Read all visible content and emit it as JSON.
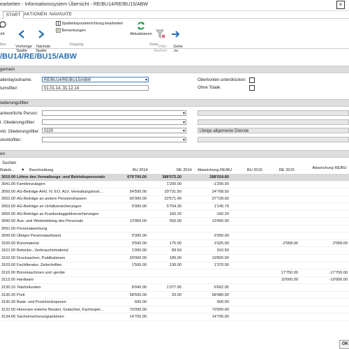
{
  "window": {
    "title": "earbeiten - Informationssystem Übersicht - RE/BU14/RE/BU15/ABW",
    "close": "×"
  },
  "tabs": [
    {
      "label": "START"
    },
    {
      "label": "AKTIONEN"
    },
    {
      "label": "NAVIGATE"
    }
  ],
  "ribbon": {
    "buttons": [
      {
        "label": "cht",
        "icon": "search-icon"
      },
      {
        "label": "Vorherige\nSpalte",
        "icon": "arrow-left-icon"
      },
      {
        "label": "Nächste\nSpalte",
        "icon": "arrow-right-icon"
      },
      {
        "label": "Spaltenlayouteinrichtung bearbeiten",
        "icon": "layout-icon"
      },
      {
        "label": "Bemerkungen",
        "icon": "note-icon"
      },
      {
        "label": "Aktualisieren",
        "icon": "refresh-icon"
      },
      {
        "label": "Filter\nlöschen",
        "icon": "clear-filter-icon"
      },
      {
        "label": "Gehe\nzu",
        "icon": "goto-icon"
      }
    ],
    "groups": {
      "g1": "lten",
      "g2": "Vorgang",
      "g3": "Seite"
    }
  },
  "page_title": "/BU14/RE/BU15/ABW",
  "allgemein": {
    "header": "gemein",
    "layout_label": "altenlayoutname:",
    "layout_value": "RE/BU14/RE/BU15/ABW",
    "date_label": "tumsfilter:",
    "date_value": "01.01.14..31.12.14",
    "suppress_label": "Oberkonten unterdrücken:",
    "totals_label": "Ohne Totale:"
  },
  "gliederung": {
    "header": "iederungsfilter",
    "person_label": "antwortliche Person:",
    "filter1_label": "t. Gliederungsfilter:",
    "filter2_label": "nkt. Gliederungsfilter:",
    "filter2_value": "0220",
    "filter2_desc": "Übrige allgemeine Dienste",
    "konto_label": "ukontofilter:"
  },
  "lines": {
    "header": "en",
    "search": "Suchen",
    "columns": [
      "Rubrik...",
      "Beschreibung",
      "BU 2014",
      "RE 2014",
      "Abweichung RE/BU",
      "BU 2015",
      "RE 2015",
      "Abweichung RE/BU"
    ],
    "rows": [
      [
        "3010.00",
        "Löhne des Verwaltungs- und Betriebspersonals",
        "679'700.00",
        "388'675.20",
        "288'024.80",
        "",
        "",
        ""
      ],
      [
        "3041.00",
        "Familienzulagen",
        "",
        "1'200.00",
        "-1'200.00",
        "",
        "",
        ""
      ],
      [
        "3050.00",
        "AG-Beiträge AHV, IV, EO, ALV, Verwaltungskost...",
        "54'500.00",
        "29'731.50",
        "24'768.50",
        "",
        "",
        ""
      ],
      [
        "3052.00",
        "AG-Beiträge an andere Pensionskassen",
        "60'300.00",
        "22'571.40",
        "37'728.60",
        "",
        "",
        ""
      ],
      [
        "3053.00",
        "AG-Beiträge an Unfallversicherungen",
        "6'900.00",
        "5'754.30",
        "1'145.70",
        "",
        "",
        ""
      ],
      [
        "3055.00",
        "AG-Beiträge an Krankentaggeldversicherungen",
        "",
        "160.20",
        "-160.20",
        "",
        "",
        ""
      ],
      [
        "3090.00",
        "Aus- und Weiterbildung des Personals",
        "13'950.00",
        "550.00",
        "13'400.00",
        "",
        "",
        ""
      ],
      [
        "3091.00",
        "Personalwerbung",
        "",
        "",
        "",
        "",
        "",
        ""
      ],
      [
        "3099.00",
        "Übriger Personalaufwand",
        "9'300.00",
        "",
        "9'300.00",
        "",
        "",
        ""
      ],
      [
        "3100.00",
        "Büromaterial",
        "3'500.00",
        "175.00",
        "3'325.00",
        "",
        "-2'058.00",
        "2'058.00"
      ],
      [
        "3101.00",
        "Betriebs-, Verbrauchsmaterial",
        "1'000.00",
        "89.50",
        "910.50",
        "",
        "",
        ""
      ],
      [
        "3102.00",
        "Drucksachen, Publikationen",
        "20'000.00",
        "180.00",
        "19'820.00",
        "",
        "",
        ""
      ],
      [
        "3103.00",
        "Fachliteratur, Zeitschriften",
        "1'500.00",
        "130.00",
        "1'370.00",
        "",
        "",
        ""
      ],
      [
        "3110.00",
        "Büromaschinen und -geräte",
        "",
        "",
        "",
        "",
        "17'750.00",
        "-17'750.00"
      ],
      [
        "3113.00",
        "Hardware",
        "",
        "",
        "",
        "",
        "10'000.00",
        "-10'000.00"
      ],
      [
        "3130.10",
        "Telefonkosten",
        "8'040.00",
        "1'377.95",
        "6'662.05",
        "",
        "",
        ""
      ],
      [
        "3130.20",
        "Porti",
        "58'500.00",
        "20.00",
        "58'480.00",
        "",
        "",
        ""
      ],
      [
        "3130.30",
        "Bank- und Postcheckspesen",
        "600.00",
        "",
        "600.00",
        "",
        "",
        ""
      ],
      [
        "3132.00",
        "Honorare externe Berater, Gutachter, Fachexper...",
        "70'000.00",
        "",
        "70'000.00",
        "",
        "",
        ""
      ],
      [
        "3134.00",
        "Sachversicherungsprämien",
        "14'700.00",
        "",
        "14'700.00",
        "",
        "",
        ""
      ]
    ]
  },
  "ok_label": "OK",
  "colors": {
    "accent": "#2a6fb0",
    "section_bg": "#dddddd",
    "selected_row": "#d9d9d9"
  }
}
